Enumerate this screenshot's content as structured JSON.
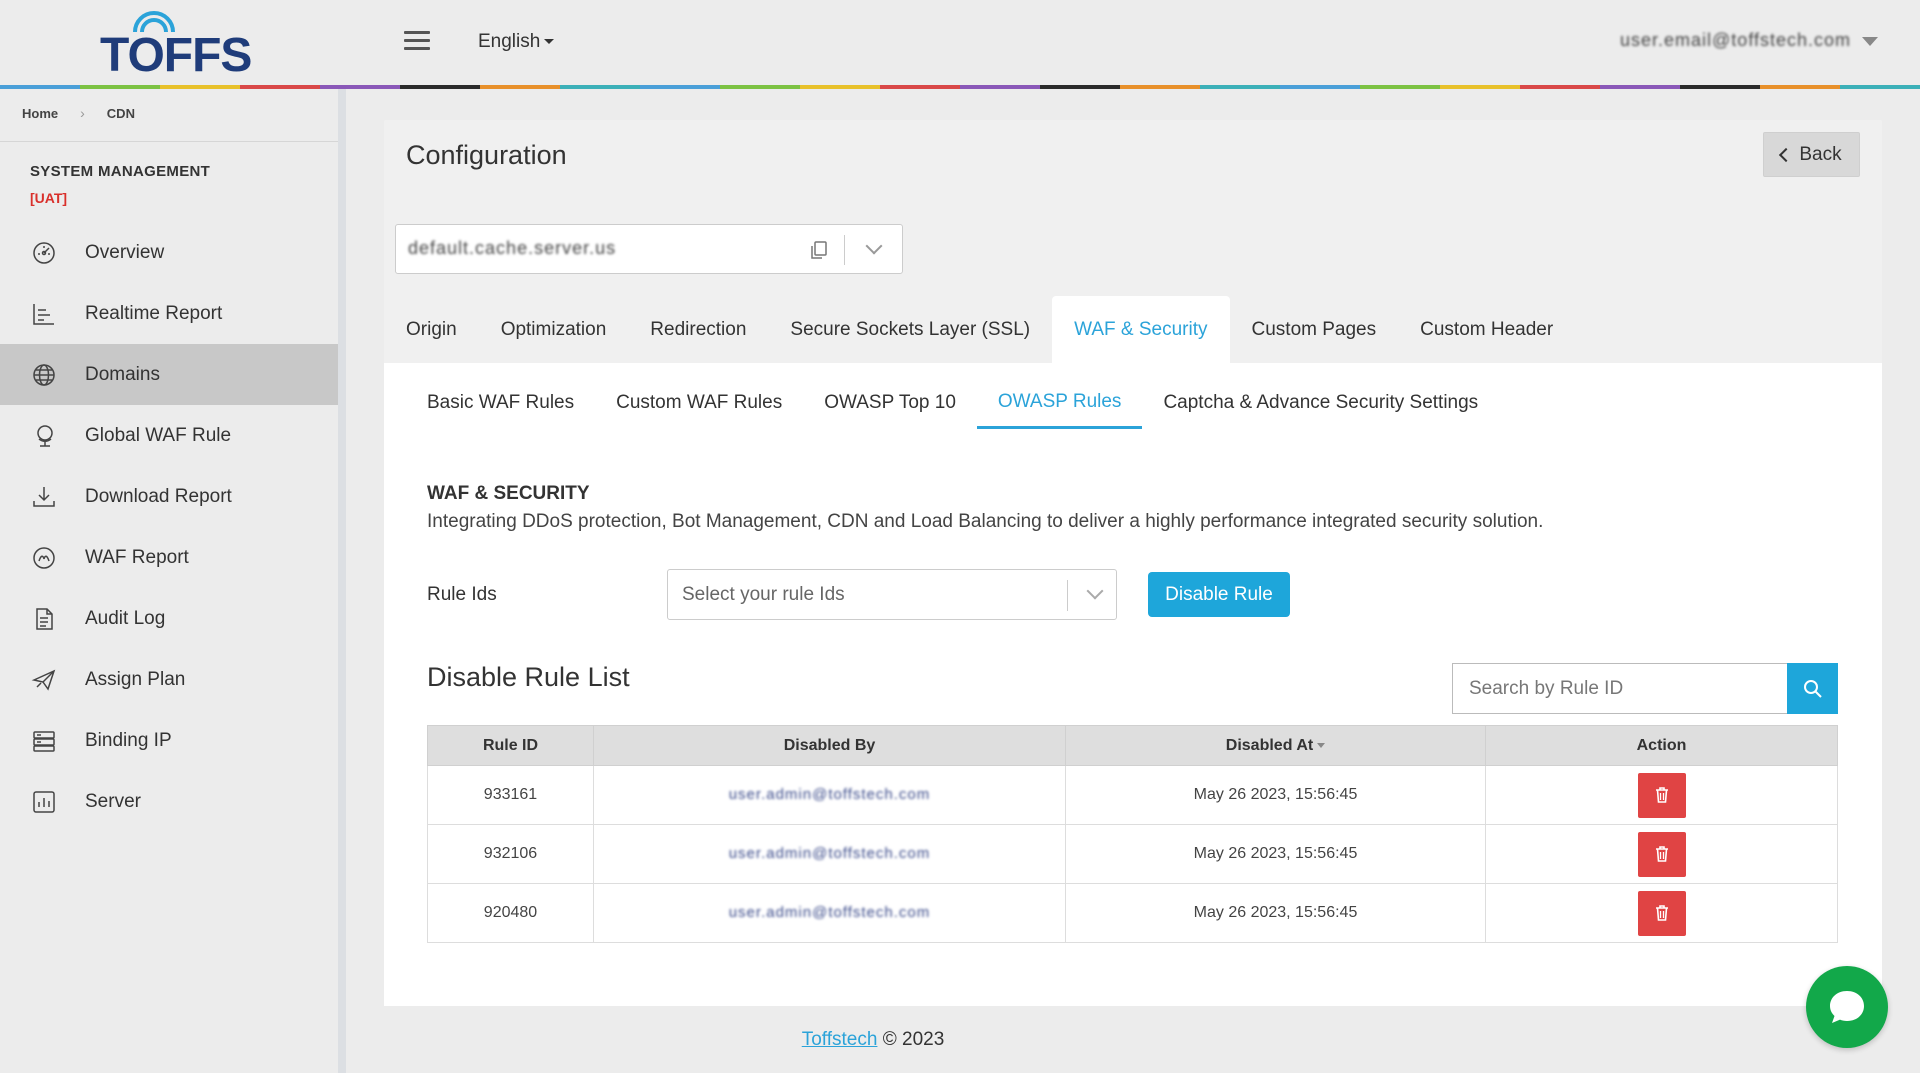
{
  "header": {
    "logo_text": "TOFFS",
    "menu_icon": "hamburger-icon",
    "language": "English",
    "user_email": "user.email@toffstech.com"
  },
  "colors": {
    "accent": "#2ba3d9",
    "primary_button": "#1ea6da",
    "danger": "#e04444",
    "chat": "#12a84a",
    "env_label": "#d9302b",
    "rainbow": [
      "#4a9fd8",
      "#7cc243",
      "#e8c12a",
      "#d94848",
      "#8a58b8",
      "#2a2a2a",
      "#e8902a",
      "#3cb0b8"
    ]
  },
  "breadcrumb": {
    "home": "Home",
    "current": "CDN"
  },
  "sidebar": {
    "title": "SYSTEM MANAGEMENT",
    "env": "[UAT]",
    "items": [
      {
        "label": "Overview",
        "icon": "dashboard-icon"
      },
      {
        "label": "Realtime Report",
        "icon": "chart-icon"
      },
      {
        "label": "Domains",
        "icon": "globe-icon",
        "active": true
      },
      {
        "label": "Global WAF Rule",
        "icon": "globe-stand-icon"
      },
      {
        "label": "Download Report",
        "icon": "download-icon"
      },
      {
        "label": "WAF Report",
        "icon": "gauge-icon"
      },
      {
        "label": "Audit Log",
        "icon": "document-icon"
      },
      {
        "label": "Assign Plan",
        "icon": "paper-plane-icon"
      },
      {
        "label": "Binding IP",
        "icon": "server-icon"
      },
      {
        "label": "Server",
        "icon": "bar-chart-icon"
      }
    ]
  },
  "main": {
    "title": "Configuration",
    "back_label": "Back",
    "domain_value": "default.cache.server.us",
    "tabs": [
      {
        "label": "Origin"
      },
      {
        "label": "Optimization"
      },
      {
        "label": "Redirection"
      },
      {
        "label": "Secure Sockets Layer (SSL)"
      },
      {
        "label": "WAF & Security",
        "active": true
      },
      {
        "label": "Custom Pages"
      },
      {
        "label": "Custom Header"
      }
    ],
    "subtabs": [
      {
        "label": "Basic WAF Rules"
      },
      {
        "label": "Custom WAF Rules"
      },
      {
        "label": "OWASP Top 10"
      },
      {
        "label": "OWASP Rules",
        "active": true
      },
      {
        "label": "Captcha & Advance Security Settings"
      }
    ],
    "section_title": "WAF & SECURITY",
    "section_desc": "Integrating DDoS protection, Bot Management, CDN and Load Balancing to deliver a highly performance integrated security solution.",
    "rule_ids_label": "Rule Ids",
    "rule_ids_placeholder": "Select your rule Ids",
    "disable_button": "Disable Rule",
    "list_title": "Disable Rule List",
    "search_placeholder": "Search by Rule ID",
    "table": {
      "headers": [
        "Rule ID",
        "Disabled By",
        "Disabled At",
        "Action"
      ],
      "rows": [
        {
          "rule_id": "933161",
          "disabled_by": "user.admin@toffstech.com",
          "disabled_at": "May 26 2023, 15:56:45"
        },
        {
          "rule_id": "932106",
          "disabled_by": "user.admin@toffstech.com",
          "disabled_at": "May 26 2023, 15:56:45"
        },
        {
          "rule_id": "920480",
          "disabled_by": "user.admin@toffstech.com",
          "disabled_at": "May 26 2023, 15:56:45"
        }
      ]
    }
  },
  "footer": {
    "link": "Toffstech",
    "text": "© 2023"
  }
}
